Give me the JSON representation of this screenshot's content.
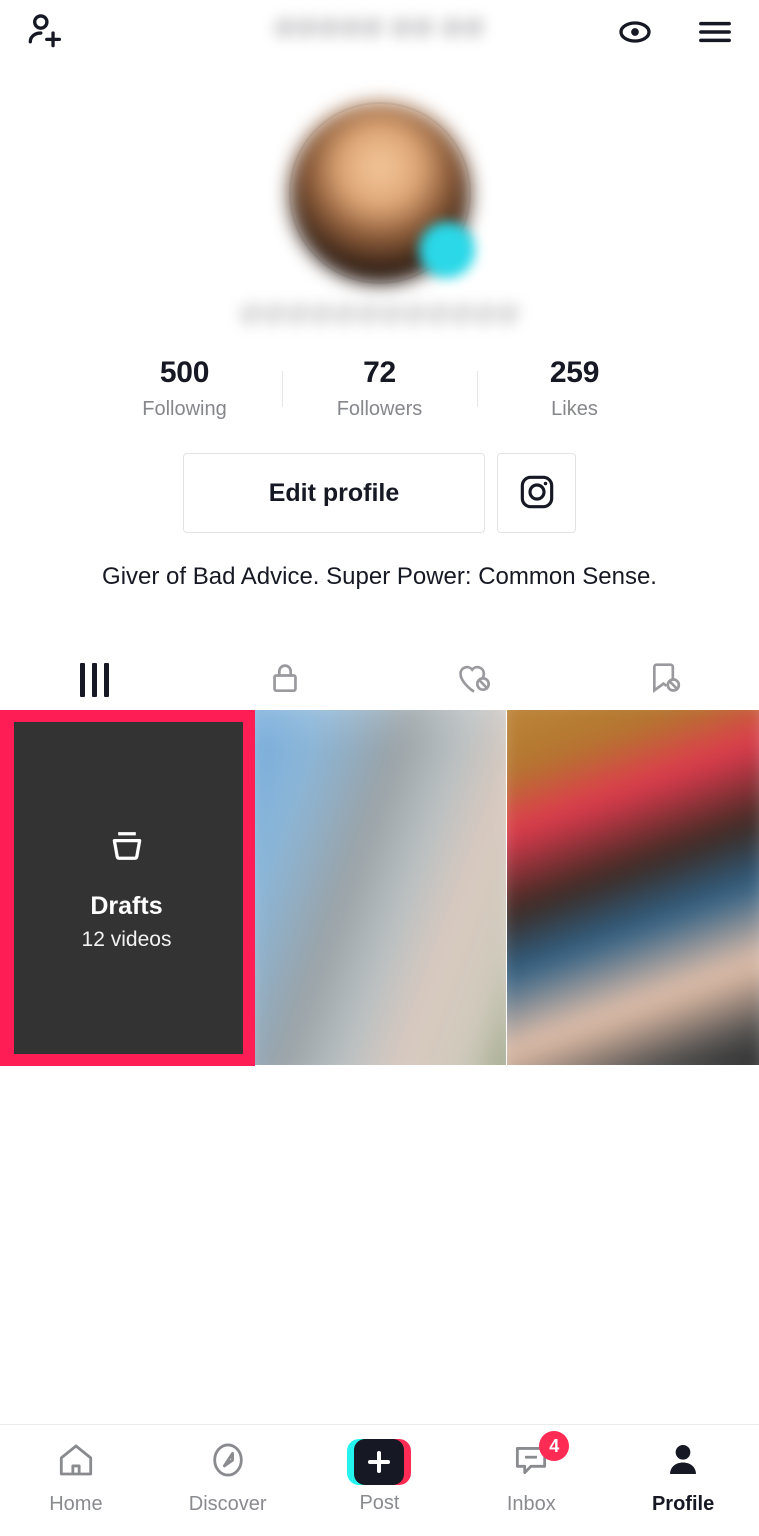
{
  "topbar": {
    "add_friends_icon": "person-add-icon",
    "username_redacted": "@@@@@ @@ @@",
    "views_icon": "eye-icon",
    "menu_icon": "hamburger-menu-icon"
  },
  "profile": {
    "avatar_icon": "avatar",
    "avatar_badge_icon": "status-badge",
    "handle_redacted": "@@@@@@@@@@@@",
    "stats": [
      {
        "count": "500",
        "label": "Following"
      },
      {
        "count": "72",
        "label": "Followers"
      },
      {
        "count": "259",
        "label": "Likes"
      }
    ],
    "edit_profile_label": "Edit profile",
    "instagram_icon": "instagram-icon",
    "bio": "Giver of Bad Advice. Super Power: Common Sense."
  },
  "tabs": [
    {
      "name": "videos-tab",
      "icon": "grid-icon",
      "active": true
    },
    {
      "name": "private-tab",
      "icon": "lock-icon",
      "active": false
    },
    {
      "name": "liked-tab",
      "icon": "heart-hidden-icon",
      "active": false
    },
    {
      "name": "saved-tab",
      "icon": "bookmark-hidden-icon",
      "active": false
    }
  ],
  "grid": {
    "drafts": {
      "icon": "drafts-tray-icon",
      "title": "Drafts",
      "subtitle": "12 videos",
      "highlight_color": "#fe1d55"
    },
    "thumbnails": [
      {
        "name": "video-thumbnail-1",
        "blurred": true
      },
      {
        "name": "video-thumbnail-2",
        "blurred": true
      }
    ]
  },
  "bottom_nav": [
    {
      "label": "Home",
      "icon": "home-icon",
      "active": false,
      "badge": ""
    },
    {
      "label": "Discover",
      "icon": "compass-icon",
      "active": false,
      "badge": ""
    },
    {
      "label": "Post",
      "icon": "plus-icon",
      "active": false,
      "badge": ""
    },
    {
      "label": "Inbox",
      "icon": "message-icon",
      "active": false,
      "badge": "4"
    },
    {
      "label": "Profile",
      "icon": "person-filled-icon",
      "active": true,
      "badge": ""
    }
  ],
  "colors": {
    "accent_pink": "#fe2c55",
    "accent_cyan": "#25f4ee",
    "dark": "#161823",
    "muted": "#86878b"
  }
}
